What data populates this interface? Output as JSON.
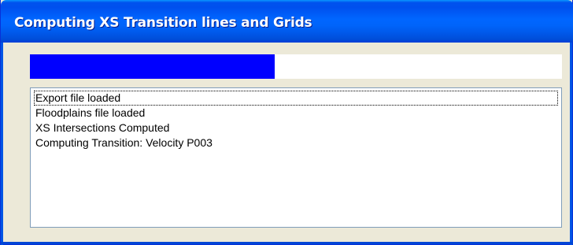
{
  "window": {
    "title": "Computing XS Transition lines and Grids"
  },
  "progress": {
    "fraction": 0.46,
    "fill_color": "#0000ff"
  },
  "log": {
    "items": [
      {
        "label": "Export file loaded",
        "focused": true
      },
      {
        "label": "Floodplains file loaded",
        "focused": false
      },
      {
        "label": "XS Intersections Computed",
        "focused": false
      },
      {
        "label": "Computing Transition: Velocity P003",
        "focused": false
      }
    ]
  },
  "colors": {
    "titlebar_blue": "#0055e5",
    "window_face": "#ece9d8"
  }
}
